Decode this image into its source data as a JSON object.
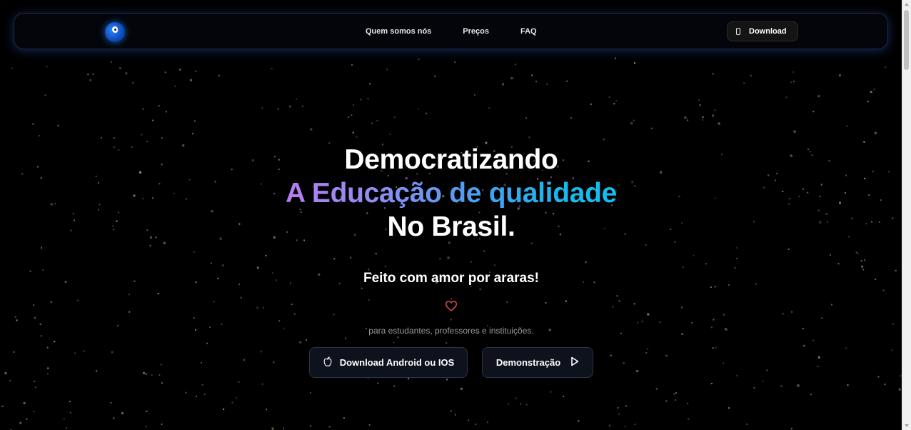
{
  "navbar": {
    "logo_icon": "parrot-logo-icon",
    "links": [
      {
        "label": "Quem somos nós"
      },
      {
        "label": "Preços"
      },
      {
        "label": "FAQ"
      }
    ],
    "download_label": "Download",
    "download_icon": "phone-icon"
  },
  "hero": {
    "line1": "Democratizando",
    "line2": "A Educação de qualidade",
    "line3": "No Brasil.",
    "subtitle": "Feito com amor por araras!",
    "heart_icon": "heart-icon",
    "tagline": "para estudantes, professores e instituições.",
    "buttons": {
      "android_label": "Download Android ou IOS",
      "android_icon": "apple-icon",
      "demo_label": "Demonstração",
      "demo_icon": "play-icon"
    }
  },
  "colors": {
    "background": "#000000",
    "gradient_start": "#b77cf2",
    "gradient_end": "#12c0ee",
    "heart": "#e5484d",
    "navbar_glow": "#2a5ac8"
  }
}
